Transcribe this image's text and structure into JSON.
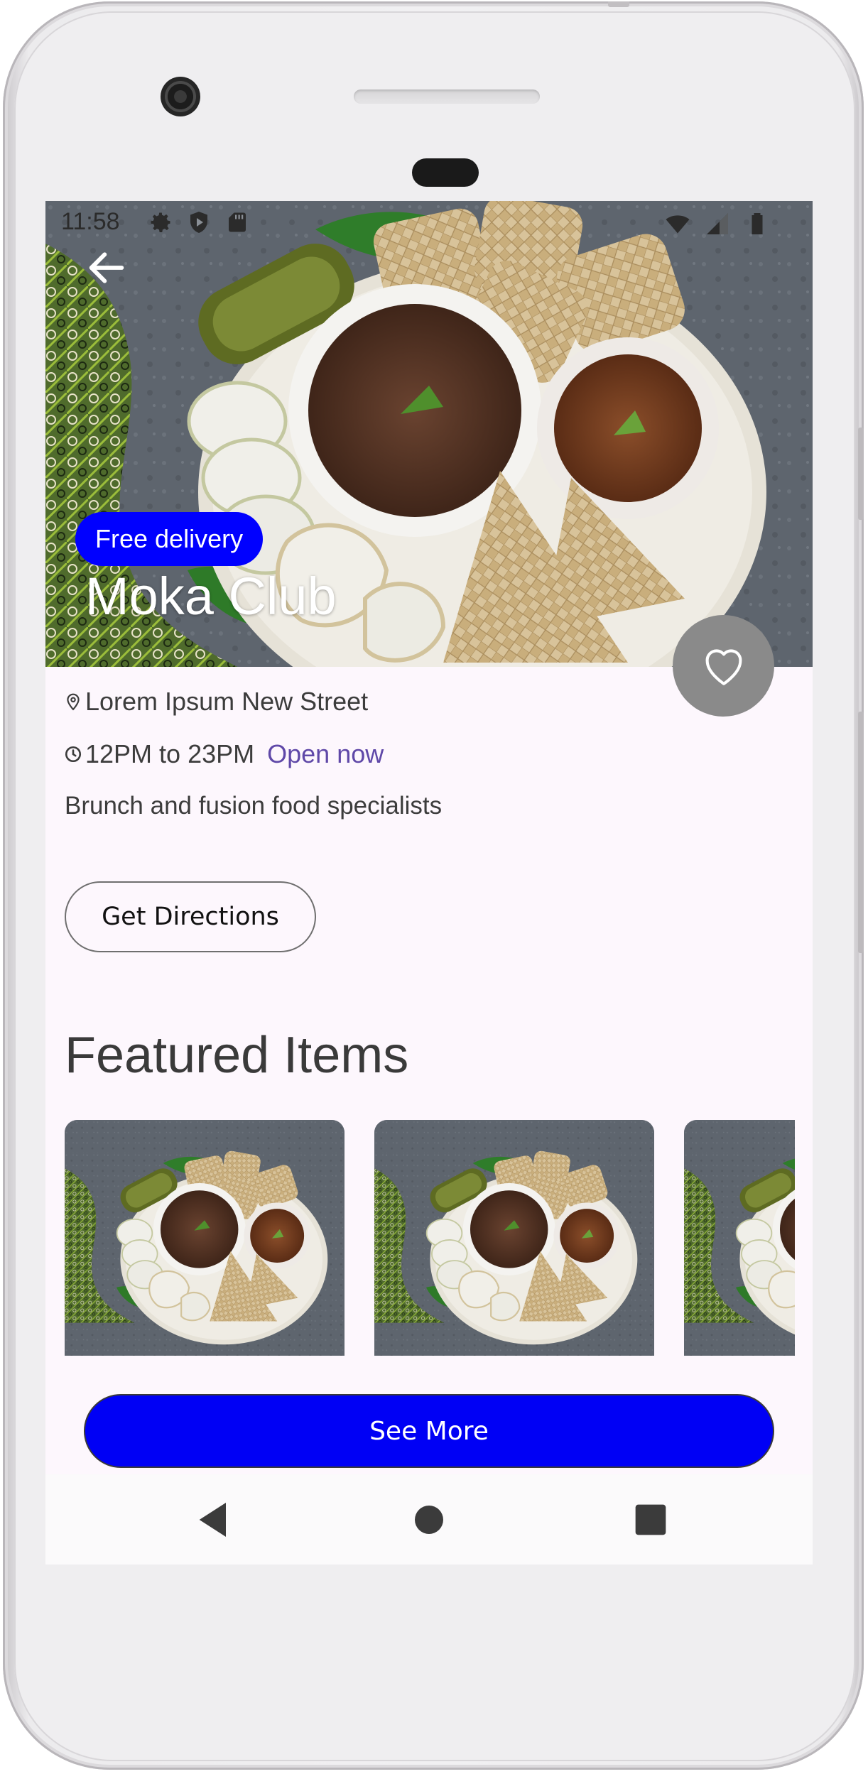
{
  "status_bar": {
    "time": "11:58",
    "left_icons": [
      "gear-icon",
      "shield-icon",
      "sd-card-icon"
    ],
    "right_icons": [
      "wifi-icon",
      "signal-icon",
      "battery-icon"
    ]
  },
  "hero": {
    "badge": "Free delivery",
    "title": "Moka Club",
    "back_icon": "arrow-left-icon",
    "favorite_icon": "heart-icon"
  },
  "details": {
    "address": "Lorem Ipsum New Street",
    "hours": "12PM to 23PM",
    "open_status": "Open now",
    "description": "Brunch and fusion food specialists"
  },
  "actions": {
    "directions_label": "Get Directions",
    "see_more_label": "See More"
  },
  "featured": {
    "title": "Featured Items",
    "items": [
      "food-platter-image",
      "food-platter-image",
      "food-platter-image"
    ]
  },
  "navigation": {
    "buttons": [
      "back-triangle-icon",
      "home-circle-icon",
      "recents-square-icon"
    ]
  },
  "colors": {
    "accent_blue": "#0000ff",
    "open_now": "#5f48a8",
    "screen_background": "#fdf7fd",
    "favorite_button": "#8a8a8a"
  }
}
